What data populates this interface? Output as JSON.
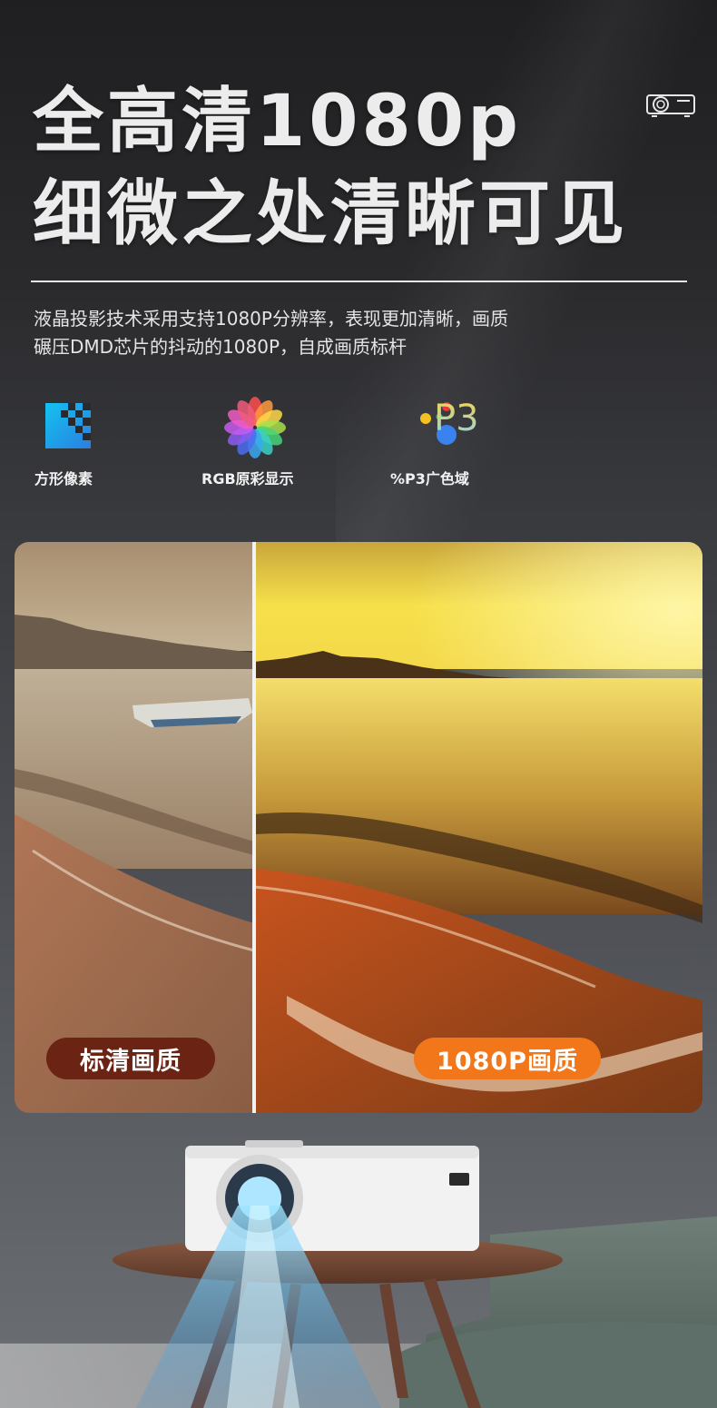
{
  "headline": {
    "line1": "全高清1080p",
    "line2": "细微之处清晰可见"
  },
  "description": {
    "line1": "液晶投影技术采用支持1080P分辨率，表现更加清晰，画质",
    "line2": "碾压DMD芯片的抖动的1080P，自成画质标杆"
  },
  "features": [
    {
      "icon": "square-pixel-icon",
      "label": "方形像素"
    },
    {
      "icon": "rgb-color-wheel-icon",
      "label": "RGB原彩显示"
    },
    {
      "icon": "p3-color-gamut-icon",
      "icon_text": "P3",
      "label": "%P3广色域"
    }
  ],
  "comparison": {
    "left_label": "标清画质",
    "right_label": "1080P画质"
  },
  "colors": {
    "sd_badge": "#6b2414",
    "hd_badge": "#f2761a",
    "pixel_icon": "#1fa8e8"
  }
}
